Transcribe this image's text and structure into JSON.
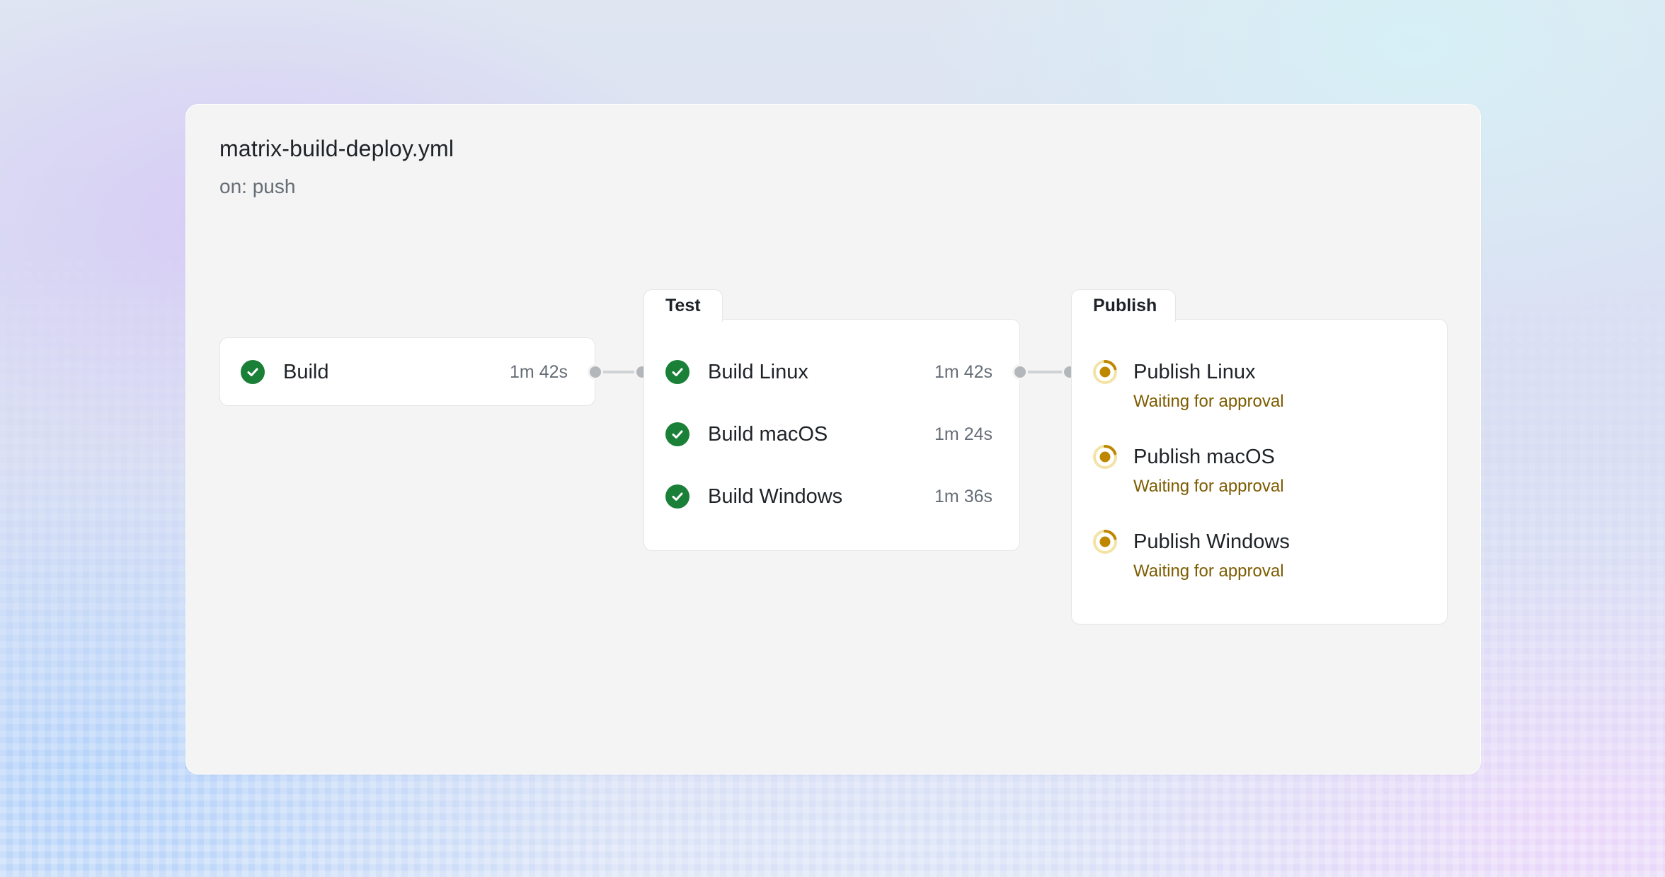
{
  "workflow": {
    "title": "matrix-build-deploy.yml",
    "trigger": "on: push"
  },
  "stages": {
    "build": {
      "jobs": [
        {
          "name": "Build",
          "duration": "1m 42s",
          "status": "success"
        }
      ]
    },
    "test": {
      "label": "Test",
      "jobs": [
        {
          "name": "Build Linux",
          "duration": "1m 42s",
          "status": "success"
        },
        {
          "name": "Build macOS",
          "duration": "1m 24s",
          "status": "success"
        },
        {
          "name": "Build Windows",
          "duration": "1m 36s",
          "status": "success"
        }
      ]
    },
    "publish": {
      "label": "Publish",
      "jobs": [
        {
          "name": "Publish Linux",
          "status_text": "Waiting for approval",
          "status": "waiting"
        },
        {
          "name": "Publish macOS",
          "status_text": "Waiting for approval",
          "status": "waiting"
        },
        {
          "name": "Publish Windows",
          "status_text": "Waiting for approval",
          "status": "waiting"
        }
      ]
    }
  },
  "icons": {
    "success": "check-circle-icon",
    "waiting": "pending-dot-icon"
  },
  "colors": {
    "success": "#1a7f37",
    "waiting": "#bf8700",
    "waiting_text": "#7d5c00"
  }
}
